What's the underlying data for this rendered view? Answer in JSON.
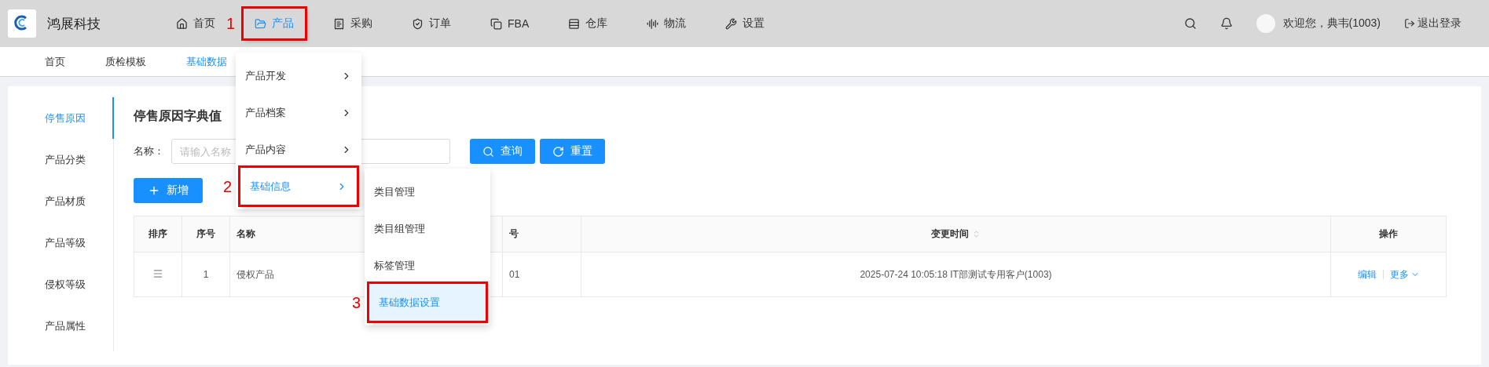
{
  "header": {
    "company": "鸿展科技",
    "nav": [
      {
        "label": "首页",
        "selected": false,
        "highlighted": false
      },
      {
        "label": "产品",
        "selected": true,
        "highlighted": true,
        "marker": "1"
      },
      {
        "label": "采购",
        "selected": false,
        "highlighted": false
      },
      {
        "label": "订单",
        "selected": false,
        "highlighted": false
      },
      {
        "label": "FBA",
        "selected": false,
        "highlighted": false
      },
      {
        "label": "仓库",
        "selected": false,
        "highlighted": false
      },
      {
        "label": "物流",
        "selected": false,
        "highlighted": false
      },
      {
        "label": "设置",
        "selected": false,
        "highlighted": false
      }
    ],
    "greeting": "欢迎您，典韦(1003)",
    "logout": "退出登录"
  },
  "tabs": [
    {
      "label": "首页",
      "selected": false
    },
    {
      "label": "质检模板",
      "selected": false
    },
    {
      "label": "基础数据",
      "selected": true
    }
  ],
  "product_menu": [
    {
      "label": "产品开发",
      "selected": false,
      "highlighted": false
    },
    {
      "label": "产品档案",
      "selected": false,
      "highlighted": false
    },
    {
      "label": "产品内容",
      "selected": false,
      "highlighted": false
    },
    {
      "label": "基础信息",
      "selected": true,
      "highlighted": true,
      "marker": "2"
    }
  ],
  "submenu": [
    {
      "label": "类目管理",
      "selected": false,
      "highlighted": false
    },
    {
      "label": "类目组管理",
      "selected": false,
      "highlighted": false
    },
    {
      "label": "标签管理",
      "selected": false,
      "highlighted": false
    },
    {
      "label": "基础数据设置",
      "selected": true,
      "highlighted": true,
      "marker": "3"
    }
  ],
  "sidebar": {
    "items": [
      {
        "label": "停售原因",
        "selected": true
      },
      {
        "label": "产品分类",
        "selected": false
      },
      {
        "label": "产品材质",
        "selected": false
      },
      {
        "label": "产品等级",
        "selected": false
      },
      {
        "label": "侵权等级",
        "selected": false
      },
      {
        "label": "产品属性",
        "selected": false
      }
    ]
  },
  "content": {
    "title": "停售原因字典值",
    "filter": {
      "label": "名称：",
      "placeholder": "请输入名称"
    },
    "buttons": {
      "search": "查询",
      "reset": "重置",
      "add": "新增"
    },
    "table": {
      "columns": [
        {
          "label": "排序",
          "sortable": false
        },
        {
          "label": "序号",
          "sortable": false
        },
        {
          "label": "名称",
          "sortable": false
        },
        {
          "label": "号",
          "sortable": false
        },
        {
          "label": "变更时间",
          "sortable": true
        },
        {
          "label": "操作",
          "sortable": false
        }
      ],
      "rows": [
        {
          "cells": [
            "",
            "1",
            "侵权产品",
            "01",
            "2025-07-24 10:05:18 IT部测试专用客户(1003)"
          ],
          "actions": [
            "编辑",
            "更多"
          ]
        }
      ]
    }
  }
}
